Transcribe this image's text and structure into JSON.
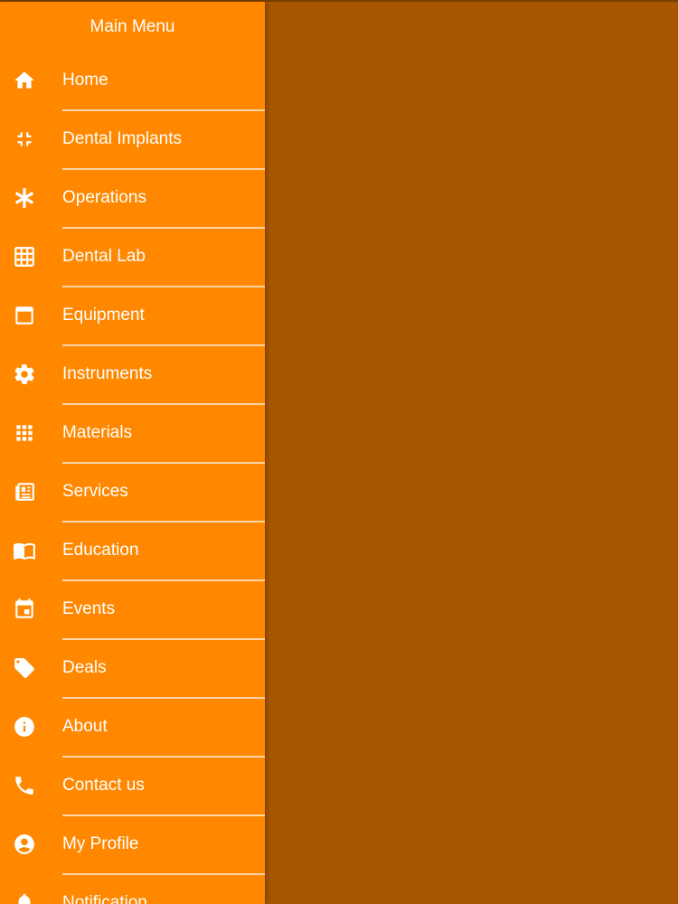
{
  "drawer": {
    "title": "Main Menu",
    "items": [
      {
        "label": "Home",
        "icon": "home-icon"
      },
      {
        "label": "Dental Implants",
        "icon": "fullscreen-exit-icon"
      },
      {
        "label": "Operations",
        "icon": "asterisk-icon"
      },
      {
        "label": "Dental Lab",
        "icon": "grid-icon"
      },
      {
        "label": "Equipment",
        "icon": "window-icon"
      },
      {
        "label": "Instruments",
        "icon": "gear-icon"
      },
      {
        "label": "Materials",
        "icon": "apps-icon"
      },
      {
        "label": "Services",
        "icon": "newspaper-icon"
      },
      {
        "label": "Education",
        "icon": "book-icon"
      },
      {
        "label": "Events",
        "icon": "calendar-icon"
      },
      {
        "label": "Deals",
        "icon": "tag-icon"
      },
      {
        "label": "About",
        "icon": "info-icon"
      },
      {
        "label": "Contact us",
        "icon": "phone-icon"
      },
      {
        "label": "My Profile",
        "icon": "account-icon"
      },
      {
        "label": "Notification",
        "icon": "bell-icon"
      }
    ]
  },
  "colors": {
    "drawer": "#ff8800",
    "overlay": "#a85700",
    "text": "#ffffff"
  }
}
